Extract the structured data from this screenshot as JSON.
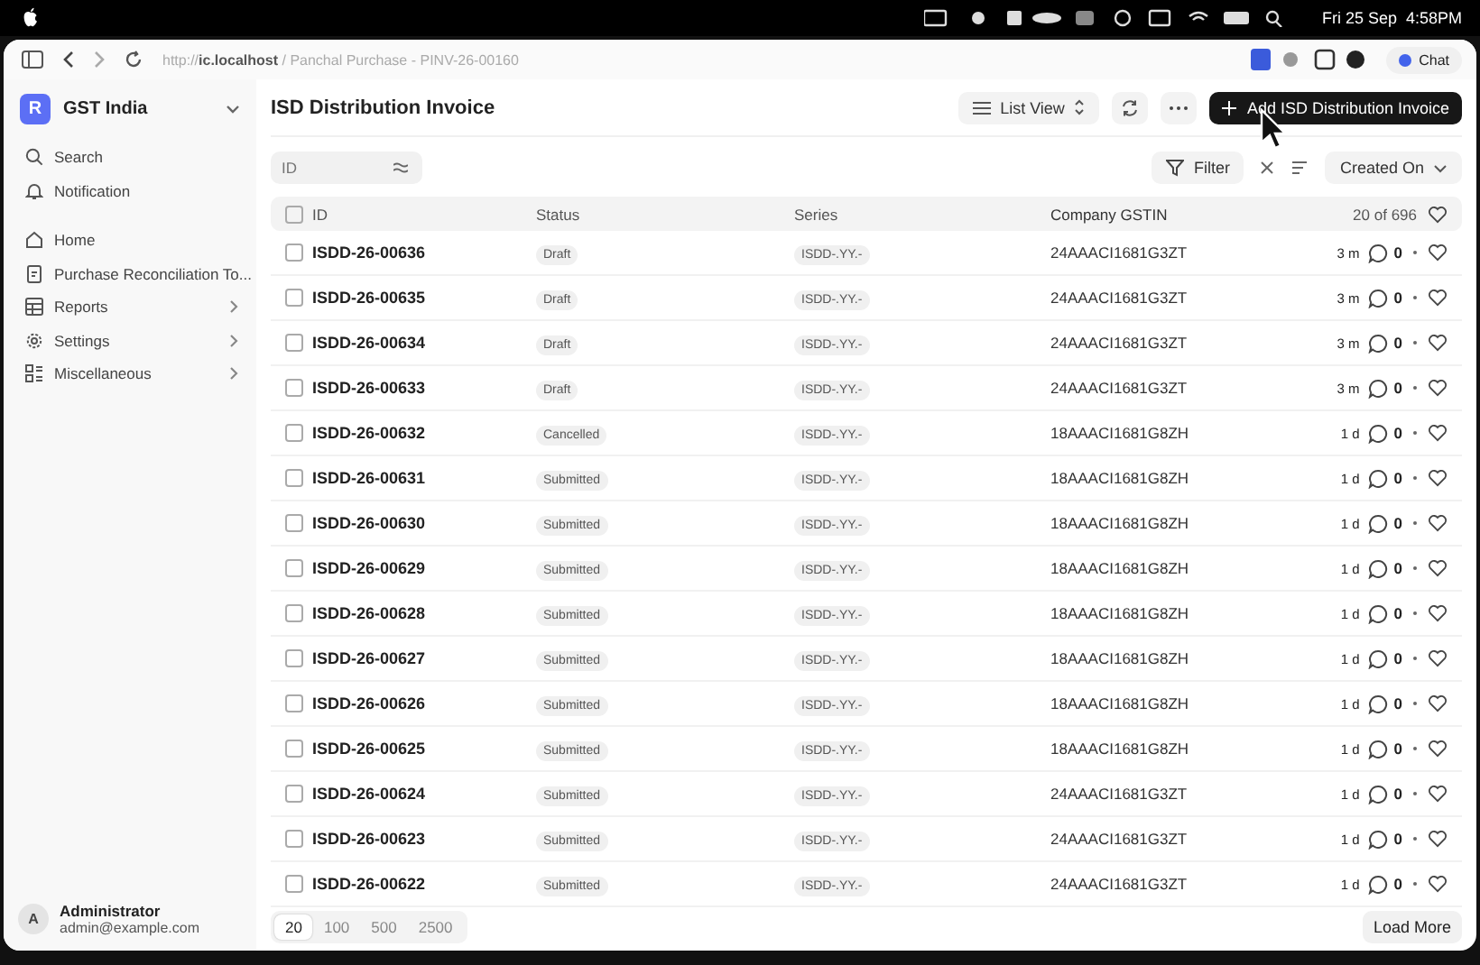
{
  "menubar": {
    "clock": "Fri 25 Sep  4:58PM"
  },
  "browser": {
    "url_prefix": "http://",
    "url_host": "ic.localhost",
    "url_rest": "/ Panchal Purchase - PINV-26-00160",
    "chat": "Chat"
  },
  "sidebar": {
    "app_name": "GST India",
    "app_letter": "R",
    "top_items": [
      {
        "label": "Search",
        "kind": "search"
      },
      {
        "label": "Notification",
        "kind": "notification"
      }
    ],
    "items": [
      {
        "label": "Home",
        "kind": "home",
        "expandable": false
      },
      {
        "label": "Purchase Reconciliation To...",
        "kind": "tool",
        "expandable": false
      },
      {
        "label": "Reports",
        "kind": "reports",
        "expandable": true
      },
      {
        "label": "Settings",
        "kind": "settings",
        "expandable": true
      },
      {
        "label": "Miscellaneous",
        "kind": "misc",
        "expandable": true
      }
    ],
    "user": {
      "initial": "A",
      "name": "Administrator",
      "email": "admin@example.com"
    }
  },
  "page": {
    "title": "ISD Distribution Invoice",
    "view": "List View",
    "add_button": "Add ISD Distribution Invoice"
  },
  "filters": {
    "id_placeholder": "ID",
    "filter": "Filter",
    "sort": "Created On"
  },
  "table": {
    "all_checked": false,
    "columns": [
      "ID",
      "Status",
      "Series",
      "Company GSTIN"
    ],
    "count": "20 of 696",
    "rows": [
      {
        "id": "ISDD-26-00636",
        "status": "Draft",
        "series": "ISDD-.YY.-",
        "gstin": "24AAACI1681G3ZT",
        "age": "3 m",
        "comments": "0",
        "checked": false,
        "liked": false
      },
      {
        "id": "ISDD-26-00635",
        "status": "Draft",
        "series": "ISDD-.YY.-",
        "gstin": "24AAACI1681G3ZT",
        "age": "3 m",
        "comments": "0",
        "checked": false,
        "liked": false
      },
      {
        "id": "ISDD-26-00634",
        "status": "Draft",
        "series": "ISDD-.YY.-",
        "gstin": "24AAACI1681G3ZT",
        "age": "3 m",
        "comments": "0",
        "checked": false,
        "liked": false
      },
      {
        "id": "ISDD-26-00633",
        "status": "Draft",
        "series": "ISDD-.YY.-",
        "gstin": "24AAACI1681G3ZT",
        "age": "3 m",
        "comments": "0",
        "checked": false,
        "liked": false
      },
      {
        "id": "ISDD-26-00632",
        "status": "Cancelled",
        "series": "ISDD-.YY.-",
        "gstin": "18AAACI1681G8ZH",
        "age": "1 d",
        "comments": "0",
        "checked": false,
        "liked": false
      },
      {
        "id": "ISDD-26-00631",
        "status": "Submitted",
        "series": "ISDD-.YY.-",
        "gstin": "18AAACI1681G8ZH",
        "age": "1 d",
        "comments": "0",
        "checked": false,
        "liked": false
      },
      {
        "id": "ISDD-26-00630",
        "status": "Submitted",
        "series": "ISDD-.YY.-",
        "gstin": "18AAACI1681G8ZH",
        "age": "1 d",
        "comments": "0",
        "checked": false,
        "liked": false
      },
      {
        "id": "ISDD-26-00629",
        "status": "Submitted",
        "series": "ISDD-.YY.-",
        "gstin": "18AAACI1681G8ZH",
        "age": "1 d",
        "comments": "0",
        "checked": false,
        "liked": false
      },
      {
        "id": "ISDD-26-00628",
        "status": "Submitted",
        "series": "ISDD-.YY.-",
        "gstin": "18AAACI1681G8ZH",
        "age": "1 d",
        "comments": "0",
        "checked": false,
        "liked": false
      },
      {
        "id": "ISDD-26-00627",
        "status": "Submitted",
        "series": "ISDD-.YY.-",
        "gstin": "18AAACI1681G8ZH",
        "age": "1 d",
        "comments": "0",
        "checked": false,
        "liked": false
      },
      {
        "id": "ISDD-26-00626",
        "status": "Submitted",
        "series": "ISDD-.YY.-",
        "gstin": "18AAACI1681G8ZH",
        "age": "1 d",
        "comments": "0",
        "checked": false,
        "liked": false
      },
      {
        "id": "ISDD-26-00625",
        "status": "Submitted",
        "series": "ISDD-.YY.-",
        "gstin": "18AAACI1681G8ZH",
        "age": "1 d",
        "comments": "0",
        "checked": false,
        "liked": false
      },
      {
        "id": "ISDD-26-00624",
        "status": "Submitted",
        "series": "ISDD-.YY.-",
        "gstin": "24AAACI1681G3ZT",
        "age": "1 d",
        "comments": "0",
        "checked": false,
        "liked": false
      },
      {
        "id": "ISDD-26-00623",
        "status": "Submitted",
        "series": "ISDD-.YY.-",
        "gstin": "24AAACI1681G3ZT",
        "age": "1 d",
        "comments": "0",
        "checked": false,
        "liked": false
      },
      {
        "id": "ISDD-26-00622",
        "status": "Submitted",
        "series": "ISDD-.YY.-",
        "gstin": "24AAACI1681G3ZT",
        "age": "1 d",
        "comments": "0",
        "checked": false,
        "liked": false
      }
    ]
  },
  "footer": {
    "page_sizes": [
      {
        "label": "20",
        "selected": true
      },
      {
        "label": "100",
        "selected": false
      },
      {
        "label": "500",
        "selected": false
      },
      {
        "label": "2500",
        "selected": false
      }
    ],
    "load_more": "Load More"
  }
}
